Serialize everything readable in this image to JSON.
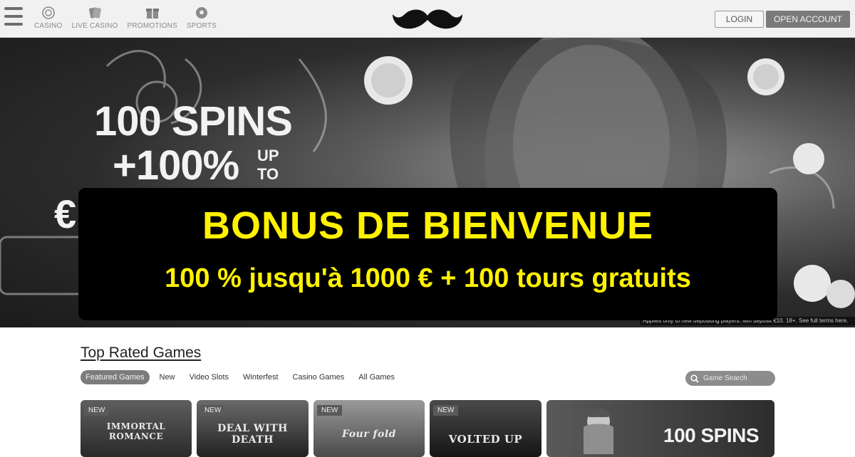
{
  "nav": {
    "items": [
      {
        "label": "CASINO",
        "icon": "chip-icon"
      },
      {
        "label": "LIVE CASINO",
        "icon": "cards-icon"
      },
      {
        "label": "PROMOTIONS",
        "icon": "gift-icon"
      },
      {
        "label": "SPORTS",
        "icon": "soccer-ball-icon"
      }
    ],
    "login_label": "LOGIN",
    "open_account_label": "OPEN ACCOUNT",
    "logo_icon": "mustache-logo-icon"
  },
  "hero": {
    "line1": "100 SPINS",
    "line2": "+100%",
    "upto": "UP TO",
    "currency_glyph": "€",
    "fine_print": "Applies only to new depositing players. Min deposit €10. 18+. See full terms here."
  },
  "banner": {
    "title": "BONUS DE BIENVENUE",
    "subtitle": "100 % jusqu'à 1000 € + 100 tours gratuits"
  },
  "games": {
    "section_title": "Top Rated Games",
    "tabs": [
      "Featured Games",
      "New",
      "Video Slots",
      "Winterfest",
      "Casino Games",
      "All Games"
    ],
    "active_tab": "Featured Games",
    "search_placeholder": "Game Search",
    "tiles": [
      {
        "badge": "NEW",
        "name": "IMMORTAL ROMANCE"
      },
      {
        "badge": "NEW",
        "name": "DEAL WITH DEATH"
      },
      {
        "badge": "NEW",
        "name": "Four fold"
      },
      {
        "badge": "NEW",
        "name": "VOLTED UP"
      }
    ],
    "promo_tile": {
      "text": "100 SPINS"
    }
  },
  "colors": {
    "banner_text": "#fff200",
    "banner_bg": "#000000",
    "nav_bg": "#f1f1f1"
  }
}
